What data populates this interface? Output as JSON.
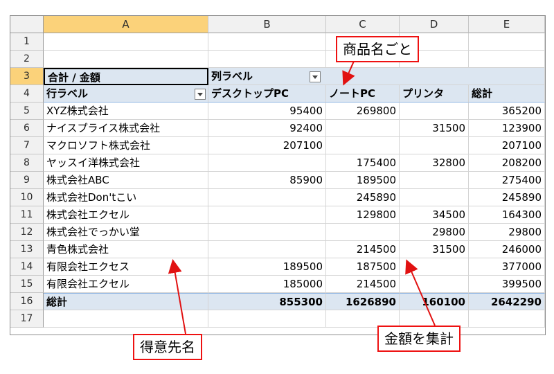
{
  "columns": [
    "A",
    "B",
    "C",
    "D",
    "E"
  ],
  "rows": [
    "1",
    "2",
    "3",
    "4",
    "5",
    "6",
    "7",
    "8",
    "9",
    "10",
    "11",
    "12",
    "13",
    "14",
    "15",
    "16",
    "17"
  ],
  "pivot": {
    "title": "合計 / 金額",
    "col_label": "列ラベル",
    "row_label": "行ラベル",
    "headers": [
      "デスクトップPC",
      "ノートPC",
      "プリンタ",
      "総計"
    ],
    "records": [
      {
        "name": "XYZ株式会社",
        "values": [
          "95400",
          "269800",
          "",
          "365200"
        ]
      },
      {
        "name": "ナイスプライス株式会社",
        "values": [
          "92400",
          "",
          "31500",
          "123900"
        ]
      },
      {
        "name": "マクロソフト株式会社",
        "values": [
          "207100",
          "",
          "",
          "207100"
        ]
      },
      {
        "name": "ヤッスイ洋株式会社",
        "values": [
          "",
          "175400",
          "32800",
          "208200"
        ]
      },
      {
        "name": "株式会社ABC",
        "values": [
          "85900",
          "189500",
          "",
          "275400"
        ]
      },
      {
        "name": "株式会社Don'tこい",
        "values": [
          "",
          "245890",
          "",
          "245890"
        ]
      },
      {
        "name": "株式会社エクセル",
        "values": [
          "",
          "129800",
          "34500",
          "164300"
        ]
      },
      {
        "name": "株式会社でっかい堂",
        "values": [
          "",
          "",
          "29800",
          "29800"
        ]
      },
      {
        "name": "青色株式会社",
        "values": [
          "",
          "214500",
          "31500",
          "246000"
        ]
      },
      {
        "name": "有限会社エクセス",
        "values": [
          "189500",
          "187500",
          "",
          "377000"
        ]
      },
      {
        "name": "有限会社エクセル",
        "values": [
          "185000",
          "214500",
          "",
          "399500"
        ]
      }
    ],
    "total_label": "総計",
    "totals": [
      "855300",
      "1626890",
      "160100",
      "2642290"
    ]
  },
  "callouts": {
    "product": "商品名ごと",
    "customer": "得意先名",
    "amount": "金額を集計"
  },
  "colors": {
    "accent_selection": "#fbd27a",
    "pivot_band": "#dce6f1",
    "callout": "#e11111"
  }
}
